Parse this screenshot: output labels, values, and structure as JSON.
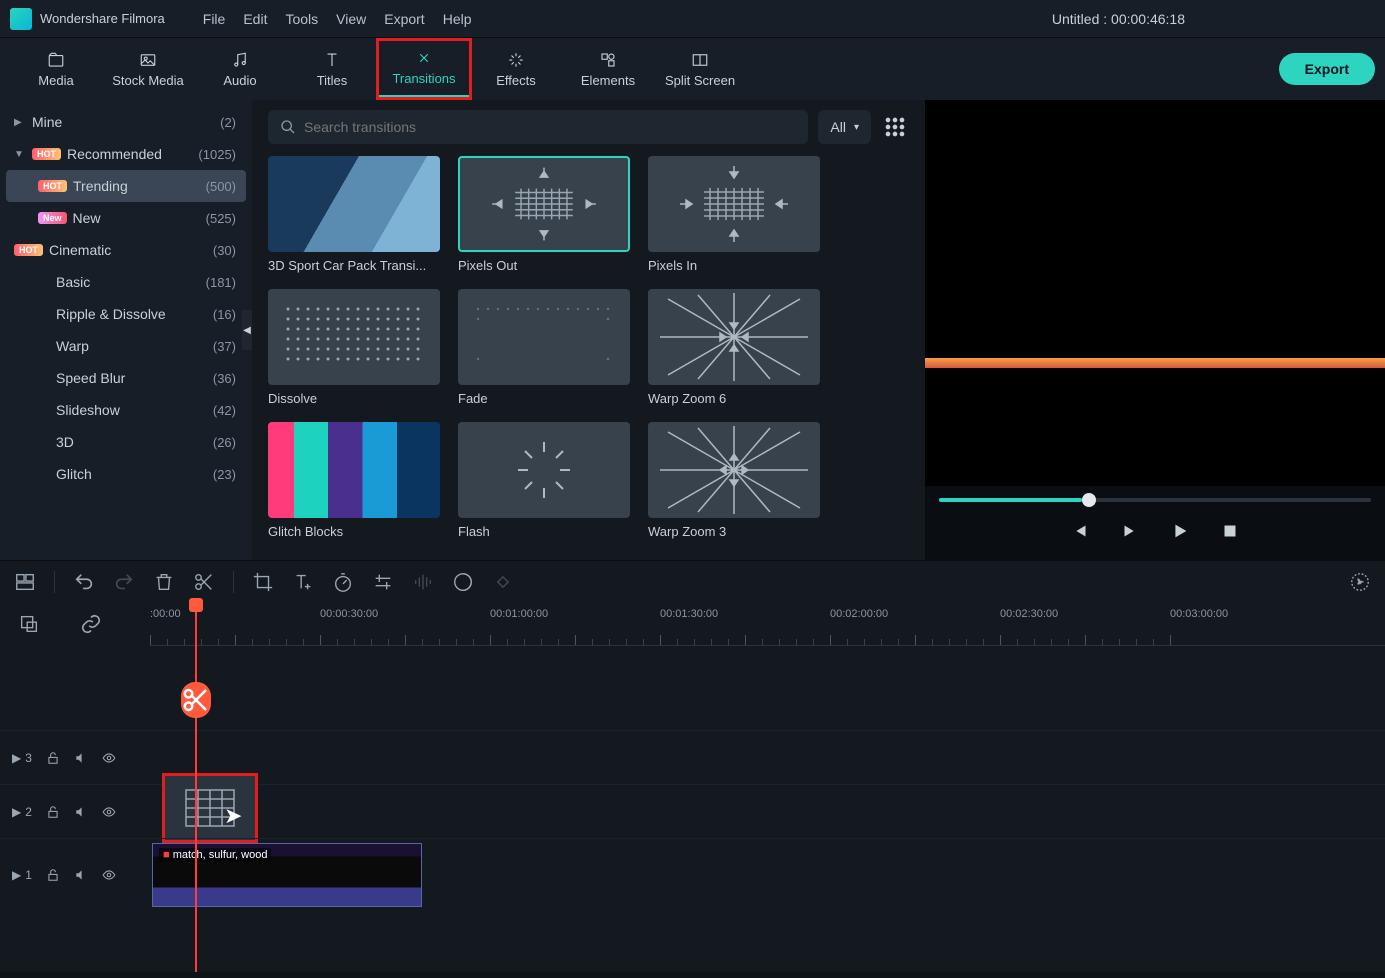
{
  "app": {
    "name": "Wondershare Filmora",
    "title": "Untitled : 00:00:46:18"
  },
  "menu": [
    "File",
    "Edit",
    "Tools",
    "View",
    "Export",
    "Help"
  ],
  "tabs": [
    {
      "label": "Media"
    },
    {
      "label": "Stock Media"
    },
    {
      "label": "Audio"
    },
    {
      "label": "Titles"
    },
    {
      "label": "Transitions"
    },
    {
      "label": "Effects"
    },
    {
      "label": "Elements"
    },
    {
      "label": "Split Screen"
    }
  ],
  "export_label": "Export",
  "search": {
    "placeholder": "Search transitions",
    "filter": "All"
  },
  "sidebar": {
    "mine": {
      "label": "Mine",
      "count": "(2)"
    },
    "recommended": {
      "label": "Recommended",
      "count": "(1025)"
    },
    "trending": {
      "label": "Trending",
      "count": "(500)"
    },
    "new": {
      "label": "New",
      "count": "(525)"
    },
    "cinematic": {
      "label": "Cinematic",
      "count": "(30)"
    },
    "items": [
      {
        "label": "Basic",
        "count": "(181)"
      },
      {
        "label": "Ripple & Dissolve",
        "count": "(16)"
      },
      {
        "label": "Warp",
        "count": "(37)"
      },
      {
        "label": "Speed Blur",
        "count": "(36)"
      },
      {
        "label": "Slideshow",
        "count": "(42)"
      },
      {
        "label": "3D",
        "count": "(26)"
      },
      {
        "label": "Glitch",
        "count": "(23)"
      }
    ]
  },
  "thumbs": [
    {
      "label": "3D Sport Car Pack Transi..."
    },
    {
      "label": "Pixels Out"
    },
    {
      "label": "Pixels In"
    },
    {
      "label": "Dissolve"
    },
    {
      "label": "Fade"
    },
    {
      "label": "Warp Zoom 6"
    },
    {
      "label": "Glitch Blocks"
    },
    {
      "label": "Flash"
    },
    {
      "label": "Warp Zoom 3"
    }
  ],
  "ruler": [
    ":00:00",
    "00:00:30:00",
    "00:01:00:00",
    "00:01:30:00",
    "00:02:00:00",
    "00:02:30:00",
    "00:03:00:00"
  ],
  "tracks": {
    "t3": "3",
    "t2": "2",
    "t1": "1"
  },
  "clip": {
    "label": "match, sulfur, wood"
  }
}
